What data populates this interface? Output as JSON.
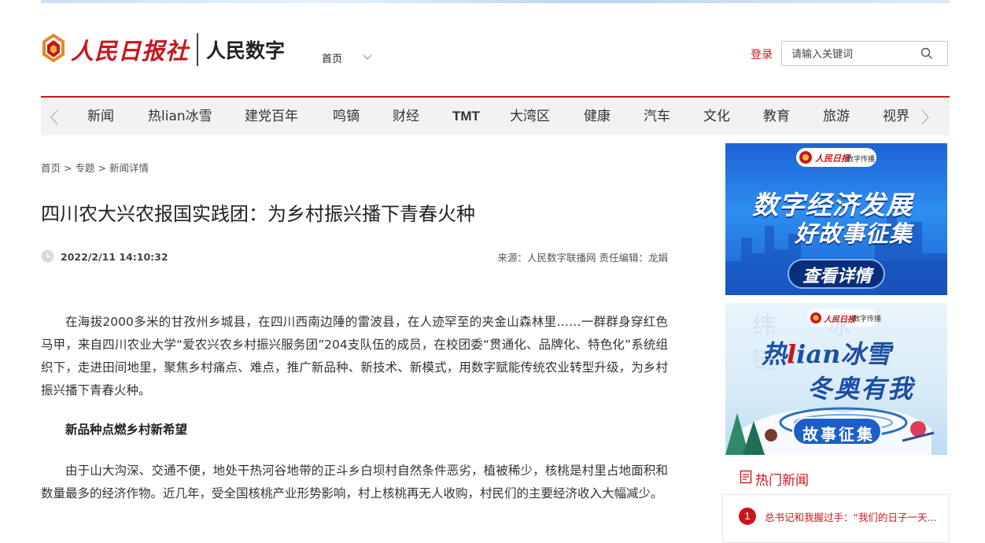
{
  "header": {
    "logo_paper": "人民日报社",
    "logo_brand": "人民数字",
    "nav_home": "首页",
    "login": "登录",
    "search_placeholder": "请输入关键词"
  },
  "channels": [
    {
      "label": "新闻",
      "bold": false
    },
    {
      "label": "热lian冰雪",
      "bold": false
    },
    {
      "label": "建党百年",
      "bold": false
    },
    {
      "label": "鸣镝",
      "bold": false
    },
    {
      "label": "财经",
      "bold": false
    },
    {
      "label": "TMT",
      "bold": true
    },
    {
      "label": "大湾区",
      "bold": false
    },
    {
      "label": "健康",
      "bold": false
    },
    {
      "label": "汽车",
      "bold": false
    },
    {
      "label": "文化",
      "bold": false
    },
    {
      "label": "教育",
      "bold": false
    },
    {
      "label": "旅游",
      "bold": false
    },
    {
      "label": "视界",
      "bold": false
    }
  ],
  "breadcrumb": [
    "首页",
    "专题",
    "新闻详情"
  ],
  "article": {
    "title": "四川农大兴农报国实践团：为乡村振兴播下青春火种",
    "time": "2022/2/11 14:10:32",
    "source": "来源：人民数字联播网 责任编辑：龙娟",
    "p1": "在海拔2000多米的甘孜州乡城县，在四川西南边陲的雷波县，在人迹罕至的夹金山森林里……一群群身穿红色马甲，来自四川农业大学“爱农兴农乡村振兴服务团”204支队伍的成员，在校团委“贯通化、品牌化、特色化”系统组织下，走进田间地里，聚焦乡村痛点、难点，推广新品种、新技术、新模式，用数字赋能传统农业转型升级，为乡村振兴播下青春火种。",
    "subheading": "新品种点燃乡村新希望",
    "p2": "由于山大沟深、交通不便，地处干热河谷地带的正斗乡白坝村自然条件恶劣，植被稀少，核桃是村里占地面积和数量最多的经济作物。近几年，受全国核桃产业形势影响，村上核桃再无人收购，村民们的主要经济收入大幅减少。"
  },
  "banner1": {
    "brand": "人民日报",
    "tag": "数字传播",
    "line1": "数字经济发展",
    "line2": "好故事征集",
    "button": "查看详情"
  },
  "banner2": {
    "brand": "人民日报",
    "tag": "数字传播",
    "line1_a": "热",
    "line1_b": "l",
    "line1_c": "i",
    "line1_d": "an冰雪",
    "line2": "冬奥有我",
    "button": "故事征集",
    "watermark": "纬 冰 链"
  },
  "hot": {
    "title": "热门新闻",
    "items": [
      {
        "num": "1",
        "text": "总书记和我握过手：“我们的日子一天..."
      }
    ]
  },
  "colors": {
    "brand_red": "#c8161d",
    "banner_blue": "#1e63d6"
  }
}
